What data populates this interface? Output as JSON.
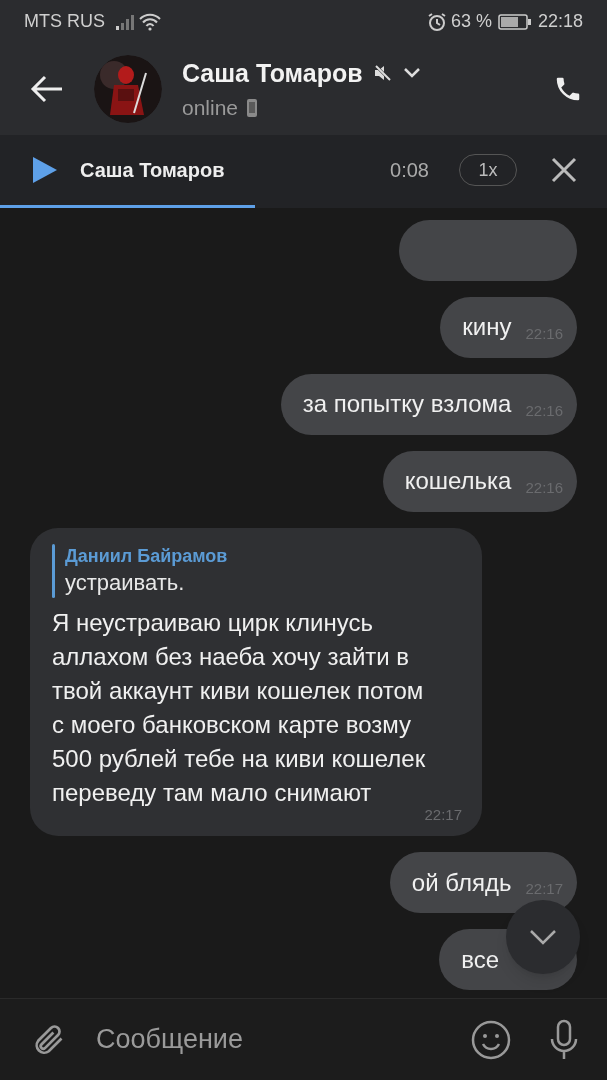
{
  "status_bar": {
    "carrier": "MTS RUS",
    "battery": "63 %",
    "time": "22:18"
  },
  "header": {
    "name": "Саша Томаров",
    "muted": true,
    "status": "online"
  },
  "player": {
    "title": "Саша Томаров",
    "time": "0:08",
    "speed": "1x",
    "level": 0.42
  },
  "messages": [
    {
      "kind": "text",
      "outgoing": true,
      "text": "кину",
      "time": "22:16"
    },
    {
      "kind": "text",
      "outgoing": true,
      "text": "за попытку взлома",
      "time": "22:16"
    },
    {
      "kind": "text",
      "outgoing": true,
      "text": "кошелька",
      "time": "22:16"
    },
    {
      "kind": "reply",
      "outgoing": false,
      "reply_author": "Даниил Байрамов",
      "reply_text": "устраивать.",
      "text": "Я неустраиваю цирк клинусь аллахом без наеба хочу зайти в твой аккаунт киви кошелек потом с моего банковском карте возму 500 рублей тебе на киви кошелек переведу там мало снимают",
      "time": "22:17"
    },
    {
      "kind": "text",
      "outgoing": true,
      "text": "ой блядь",
      "time": "22:17"
    },
    {
      "kind": "text",
      "outgoing": true,
      "text": "все"
    }
  ],
  "composer": {
    "placeholder": "Сообщение"
  }
}
